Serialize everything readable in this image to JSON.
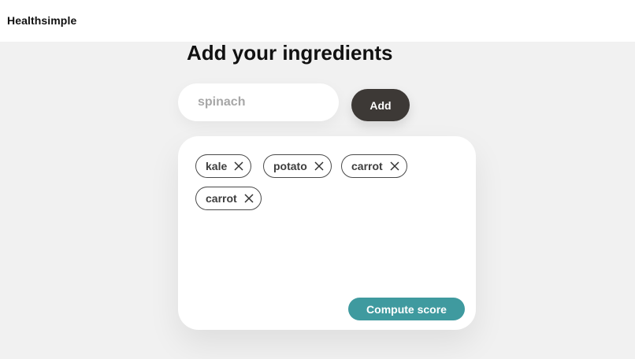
{
  "brand": {
    "name": "Healthsimple"
  },
  "page": {
    "title": "Add your ingredients"
  },
  "search": {
    "placeholder": "spinach",
    "value": ""
  },
  "actions": {
    "add_label": "Add",
    "compute_label": "Compute score"
  },
  "ingredients": [
    {
      "label": "kale"
    },
    {
      "label": "potato"
    },
    {
      "label": "carrot"
    },
    {
      "label": "carrot"
    }
  ],
  "colors": {
    "accent": "#3f9a9f",
    "dark_button": "#3d3936",
    "page_background": "#f1f1f1"
  }
}
